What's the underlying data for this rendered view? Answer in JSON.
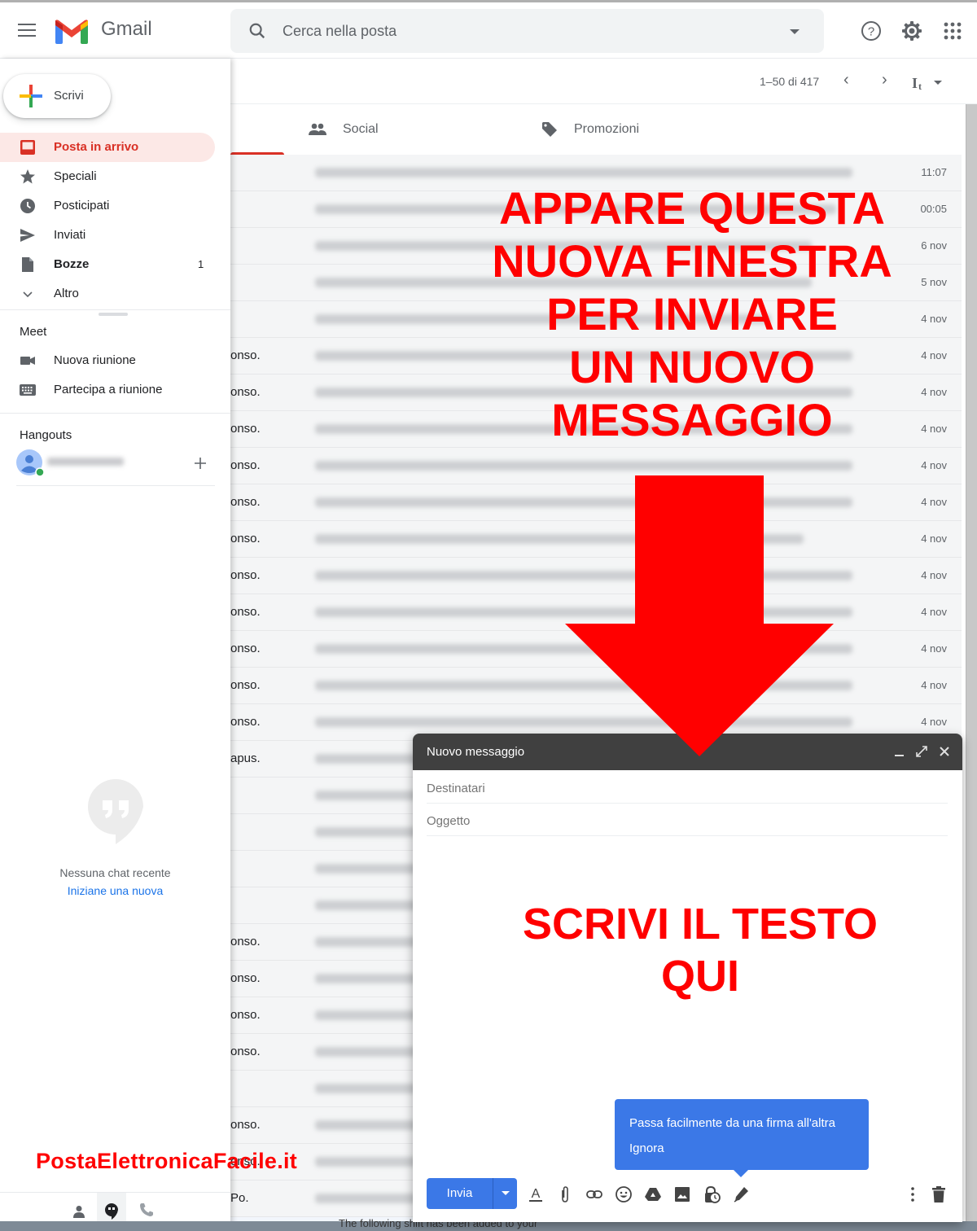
{
  "app": {
    "name": "Gmail"
  },
  "search": {
    "placeholder": "Cerca nella posta"
  },
  "header_icons": [
    "help-icon",
    "settings-icon",
    "apps-icon"
  ],
  "toolbar": {
    "pagination": "1–50 di 417",
    "prev": "‹",
    "next": "›"
  },
  "tabs": [
    {
      "label": "Social",
      "icon": "people-icon"
    },
    {
      "label": "Promozioni",
      "icon": "tag-icon"
    }
  ],
  "sidebar": {
    "compose_label": "Scrivi",
    "items": [
      {
        "label": "Posta in arrivo",
        "icon": "inbox-icon",
        "active": true
      },
      {
        "label": "Speciali",
        "icon": "star-icon"
      },
      {
        "label": "Posticipati",
        "icon": "clock-icon"
      },
      {
        "label": "Inviati",
        "icon": "send-icon"
      },
      {
        "label": "Bozze",
        "icon": "draft-icon",
        "count": "1"
      },
      {
        "label": "Altro",
        "icon": "chevron-down-icon"
      }
    ],
    "meet": {
      "heading": "Meet",
      "items": [
        {
          "label": "Nuova riunione",
          "icon": "video-icon"
        },
        {
          "label": "Partecipa a riunione",
          "icon": "keyboard-icon"
        }
      ]
    },
    "hangouts": {
      "heading": "Hangouts",
      "empty_text": "Nessuna chat recente",
      "start_link": "Iniziane una nuova"
    }
  },
  "emails": [
    {
      "sender": "",
      "date": "11:07"
    },
    {
      "sender": "",
      "date": "00:05"
    },
    {
      "sender": "",
      "date": "6 nov"
    },
    {
      "sender": "",
      "date": "5 nov"
    },
    {
      "sender": "",
      "date": "4 nov"
    },
    {
      "sender": "onso.",
      "date": "4 nov"
    },
    {
      "sender": "onso.",
      "date": "4 nov"
    },
    {
      "sender": "onso.",
      "date": "4 nov"
    },
    {
      "sender": "onso.",
      "date": "4 nov"
    },
    {
      "sender": "onso.",
      "date": "4 nov"
    },
    {
      "sender": "onso.",
      "date": "4 nov"
    },
    {
      "sender": "onso.",
      "date": "4 nov"
    },
    {
      "sender": "onso.",
      "date": "4 nov"
    },
    {
      "sender": "onso.",
      "date": "4 nov"
    },
    {
      "sender": "onso.",
      "date": "4 nov"
    },
    {
      "sender": "onso.",
      "date": "4 nov"
    },
    {
      "sender": "apus.",
      "date": ""
    },
    {
      "sender": "",
      "date": ""
    },
    {
      "sender": "",
      "date": ""
    },
    {
      "sender": "",
      "date": ""
    },
    {
      "sender": "",
      "date": ""
    },
    {
      "sender": "onso.",
      "date": ""
    },
    {
      "sender": "onso.",
      "date": ""
    },
    {
      "sender": "onso.",
      "date": ""
    },
    {
      "sender": "onso.",
      "date": ""
    },
    {
      "sender": "",
      "date": ""
    },
    {
      "sender": "onso.",
      "date": ""
    },
    {
      "sender": "onso.",
      "date": ""
    },
    {
      "sender": "Po.",
      "date": ""
    }
  ],
  "compose": {
    "title": "Nuovo messaggio",
    "to_placeholder": "Destinatari",
    "subject_placeholder": "Oggetto",
    "send_label": "Invia",
    "tooltip_text": "Passa facilmente da una firma all'altra",
    "tooltip_dismiss": "Ignora"
  },
  "annotations": {
    "top": [
      "APPARE QUESTA",
      "NUOVA FINESTRA",
      "PER INVIARE",
      "UN NUOVO",
      "MESSAGGIO"
    ],
    "body": [
      "SCRIVI IL TESTO",
      "QUI"
    ],
    "watermark": "PostaElettronicaFacile.it",
    "color": "#ff0000"
  },
  "background_text": "The following shift has been added to your"
}
